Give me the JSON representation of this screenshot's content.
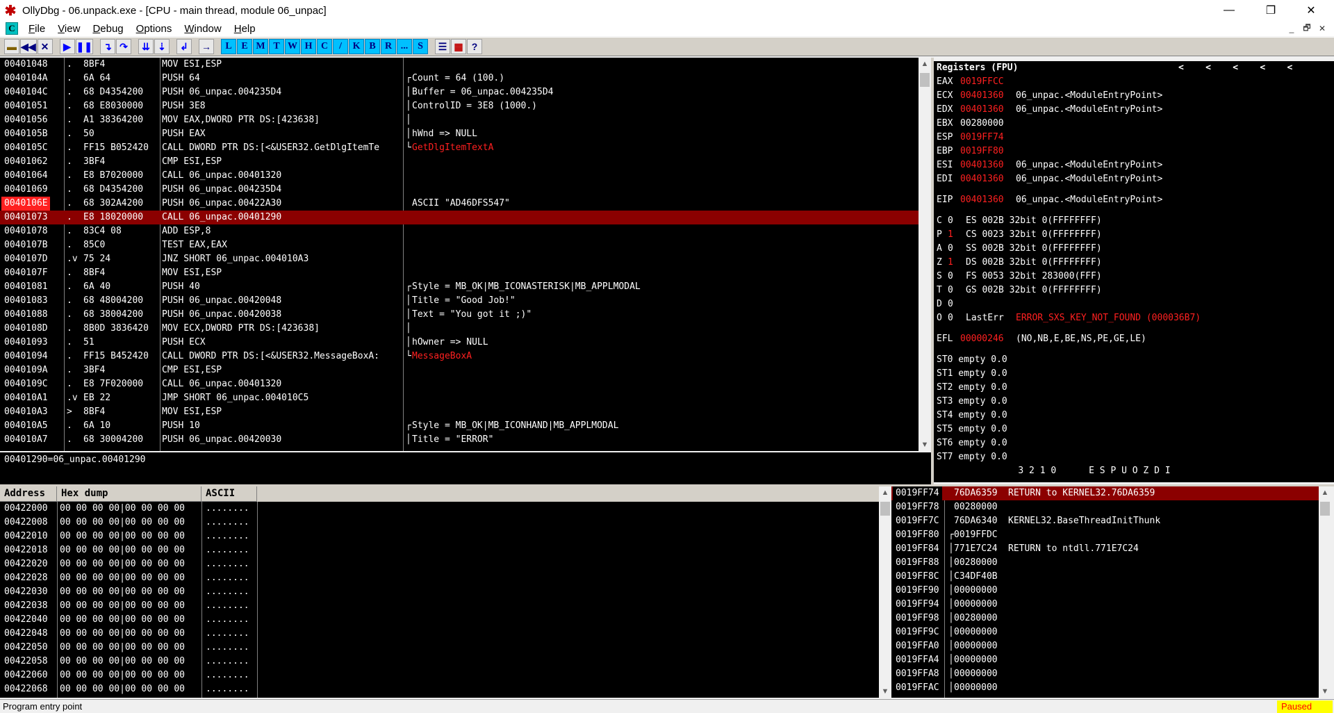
{
  "window": {
    "title": "OllyDbg - 06.unpack.exe - [CPU - main thread, module 06_unpac]",
    "minimize": "—",
    "restore": "❐",
    "close": "✕"
  },
  "menu": {
    "items": [
      "File",
      "View",
      "Debug",
      "Options",
      "Window",
      "Help"
    ],
    "mdi_min": "_",
    "mdi_restore": "🗗",
    "mdi_close": "✕"
  },
  "toolbar": {
    "letters": [
      "L",
      "E",
      "M",
      "T",
      "W",
      "H",
      "C",
      "/",
      "K",
      "B",
      "R",
      "...",
      "S"
    ]
  },
  "disasm": {
    "rows": [
      {
        "addr": "00401048",
        "m": ".",
        "hex": "8BF4",
        "asm": "MOV ESI,ESP",
        "cmt": "",
        "br": ""
      },
      {
        "addr": "0040104A",
        "m": ".",
        "hex": "6A 64",
        "asm": "PUSH 64",
        "cmt": "Count = 64 (100.)",
        "br": "┌"
      },
      {
        "addr": "0040104C",
        "m": ".",
        "hex": "68 D4354200",
        "asm": "PUSH 06_unpac.004235D4",
        "cmt": "Buffer = 06_unpac.004235D4",
        "br": "│"
      },
      {
        "addr": "00401051",
        "m": ".",
        "hex": "68 E8030000",
        "asm": "PUSH 3E8",
        "cmt": "ControlID = 3E8 (1000.)",
        "br": "│"
      },
      {
        "addr": "00401056",
        "m": ".",
        "hex": "A1 38364200",
        "asm": "MOV EAX,DWORD PTR DS:[423638]",
        "cmt": "",
        "br": "│"
      },
      {
        "addr": "0040105B",
        "m": ".",
        "hex": "50",
        "asm": "PUSH EAX",
        "cmt": "hWnd => NULL",
        "br": "│"
      },
      {
        "addr": "0040105C",
        "m": ".",
        "hex": "FF15 B052420",
        "asm": "CALL DWORD PTR DS:[<&USER32.GetDlgItemTe",
        "cmt": "GetDlgItemTextA",
        "br": "└",
        "cmtred": true
      },
      {
        "addr": "00401062",
        "m": ".",
        "hex": "3BF4",
        "asm": "CMP ESI,ESP",
        "cmt": "",
        "br": ""
      },
      {
        "addr": "00401064",
        "m": ".",
        "hex": "E8 B7020000",
        "asm": "CALL 06_unpac.00401320",
        "cmt": "",
        "br": ""
      },
      {
        "addr": "00401069",
        "m": ".",
        "hex": "68 D4354200",
        "asm": "PUSH 06_unpac.004235D4",
        "cmt": "",
        "br": ""
      },
      {
        "addr": "0040106E",
        "m": ".",
        "hex": "68 302A4200",
        "asm": "PUSH 06_unpac.00422A30",
        "cmt": "ASCII \"AD46DFS547\"",
        "br": "",
        "addrhl": true
      },
      {
        "addr": "00401073",
        "m": ".",
        "hex": "E8 18020000",
        "asm": "CALL 06_unpac.00401290",
        "cmt": "",
        "br": "",
        "sel": true
      },
      {
        "addr": "00401078",
        "m": ".",
        "hex": "83C4 08",
        "asm": "ADD ESP,8",
        "cmt": "",
        "br": ""
      },
      {
        "addr": "0040107B",
        "m": ".",
        "hex": "85C0",
        "asm": "TEST EAX,EAX",
        "cmt": "",
        "br": ""
      },
      {
        "addr": "0040107D",
        "m": ".v",
        "hex": "75 24",
        "asm": "JNZ SHORT 06_unpac.004010A3",
        "cmt": "",
        "br": ""
      },
      {
        "addr": "0040107F",
        "m": ".",
        "hex": "8BF4",
        "asm": "MOV ESI,ESP",
        "cmt": "",
        "br": ""
      },
      {
        "addr": "00401081",
        "m": ".",
        "hex": "6A 40",
        "asm": "PUSH 40",
        "cmt": "Style = MB_OK|MB_ICONASTERISK|MB_APPLMODAL",
        "br": "┌"
      },
      {
        "addr": "00401083",
        "m": ".",
        "hex": "68 48004200",
        "asm": "PUSH 06_unpac.00420048",
        "cmt": "Title = \"Good Job!\"",
        "br": "│"
      },
      {
        "addr": "00401088",
        "m": ".",
        "hex": "68 38004200",
        "asm": "PUSH 06_unpac.00420038",
        "cmt": "Text = \"You got it ;)\"",
        "br": "│"
      },
      {
        "addr": "0040108D",
        "m": ".",
        "hex": "8B0D 3836420",
        "asm": "MOV ECX,DWORD PTR DS:[423638]",
        "cmt": "",
        "br": "│"
      },
      {
        "addr": "00401093",
        "m": ".",
        "hex": "51",
        "asm": "PUSH ECX",
        "cmt": "hOwner => NULL",
        "br": "│"
      },
      {
        "addr": "00401094",
        "m": ".",
        "hex": "FF15 B452420",
        "asm": "CALL DWORD PTR DS:[<&USER32.MessageBoxA:",
        "cmt": "MessageBoxA",
        "br": "└",
        "cmtred": true
      },
      {
        "addr": "0040109A",
        "m": ".",
        "hex": "3BF4",
        "asm": "CMP ESI,ESP",
        "cmt": "",
        "br": ""
      },
      {
        "addr": "0040109C",
        "m": ".",
        "hex": "E8 7F020000",
        "asm": "CALL 06_unpac.00401320",
        "cmt": "",
        "br": ""
      },
      {
        "addr": "004010A1",
        "m": ".v",
        "hex": "EB 22",
        "asm": "JMP SHORT 06_unpac.004010C5",
        "cmt": "",
        "br": ""
      },
      {
        "addr": "004010A3",
        "m": ">",
        "hex": "8BF4",
        "asm": "MOV ESI,ESP",
        "cmt": "",
        "br": ""
      },
      {
        "addr": "004010A5",
        "m": ".",
        "hex": "6A 10",
        "asm": "PUSH 10",
        "cmt": "Style = MB_OK|MB_ICONHAND|MB_APPLMODAL",
        "br": "┌"
      },
      {
        "addr": "004010A7",
        "m": ".",
        "hex": "68 30004200",
        "asm": "PUSH 06_unpac.00420030",
        "cmt": "Title = \"ERROR\"",
        "br": "│"
      }
    ]
  },
  "info": {
    "text": "00401290=06_unpac.00401290"
  },
  "registers": {
    "header": "Registers (FPU)",
    "arrows": "<    <    <    <    <",
    "gp": [
      {
        "n": "EAX",
        "v": "0019FFCC",
        "d": "",
        "red": true
      },
      {
        "n": "ECX",
        "v": "00401360",
        "d": "06_unpac.<ModuleEntryPoint>",
        "red": true
      },
      {
        "n": "EDX",
        "v": "00401360",
        "d": "06_unpac.<ModuleEntryPoint>",
        "red": true
      },
      {
        "n": "EBX",
        "v": "00280000",
        "d": "",
        "red": false
      },
      {
        "n": "ESP",
        "v": "0019FF74",
        "d": "",
        "red": true
      },
      {
        "n": "EBP",
        "v": "0019FF80",
        "d": "",
        "red": true
      },
      {
        "n": "ESI",
        "v": "00401360",
        "d": "06_unpac.<ModuleEntryPoint>",
        "red": true
      },
      {
        "n": "EDI",
        "v": "00401360",
        "d": "06_unpac.<ModuleEntryPoint>",
        "red": true
      }
    ],
    "eip": {
      "n": "EIP",
      "v": "00401360",
      "d": "06_unpac.<ModuleEntryPoint>"
    },
    "flags": [
      {
        "f": "C",
        "v": "0",
        "red": false,
        "seg": "ES 002B 32bit 0(FFFFFFFF)"
      },
      {
        "f": "P",
        "v": "1",
        "red": true,
        "seg": "CS 0023 32bit 0(FFFFFFFF)"
      },
      {
        "f": "A",
        "v": "0",
        "red": false,
        "seg": "SS 002B 32bit 0(FFFFFFFF)"
      },
      {
        "f": "Z",
        "v": "1",
        "red": true,
        "seg": "DS 002B 32bit 0(FFFFFFFF)"
      },
      {
        "f": "S",
        "v": "0",
        "red": false,
        "seg": "FS 0053 32bit 283000(FFF)"
      },
      {
        "f": "T",
        "v": "0",
        "red": false,
        "seg": "GS 002B 32bit 0(FFFFFFFF)"
      },
      {
        "f": "D",
        "v": "0",
        "red": false,
        "seg": ""
      }
    ],
    "lasterr": {
      "f": "O",
      "v": "0",
      "label": "LastErr",
      "val": "ERROR_SXS_KEY_NOT_FOUND (000036B7)"
    },
    "efl": {
      "n": "EFL",
      "v": "00000246",
      "d": "(NO,NB,E,BE,NS,PE,GE,LE)"
    },
    "st": [
      "ST0 empty 0.0",
      "ST1 empty 0.0",
      "ST2 empty 0.0",
      "ST3 empty 0.0",
      "ST4 empty 0.0",
      "ST5 empty 0.0",
      "ST6 empty 0.0",
      "ST7 empty 0.0"
    ],
    "fpu_footer": "               3 2 1 0      E S P U O Z D I"
  },
  "dump": {
    "headers": [
      "Address",
      "Hex dump",
      "ASCII"
    ],
    "rows": [
      {
        "a": "00422000",
        "h": "00 00 00 00|00 00 00 00",
        "s": "........"
      },
      {
        "a": "00422008",
        "h": "00 00 00 00|00 00 00 00",
        "s": "........"
      },
      {
        "a": "00422010",
        "h": "00 00 00 00|00 00 00 00",
        "s": "........"
      },
      {
        "a": "00422018",
        "h": "00 00 00 00|00 00 00 00",
        "s": "........"
      },
      {
        "a": "00422020",
        "h": "00 00 00 00|00 00 00 00",
        "s": "........"
      },
      {
        "a": "00422028",
        "h": "00 00 00 00|00 00 00 00",
        "s": "........"
      },
      {
        "a": "00422030",
        "h": "00 00 00 00|00 00 00 00",
        "s": "........"
      },
      {
        "a": "00422038",
        "h": "00 00 00 00|00 00 00 00",
        "s": "........"
      },
      {
        "a": "00422040",
        "h": "00 00 00 00|00 00 00 00",
        "s": "........"
      },
      {
        "a": "00422048",
        "h": "00 00 00 00|00 00 00 00",
        "s": "........"
      },
      {
        "a": "00422050",
        "h": "00 00 00 00|00 00 00 00",
        "s": "........"
      },
      {
        "a": "00422058",
        "h": "00 00 00 00|00 00 00 00",
        "s": "........"
      },
      {
        "a": "00422060",
        "h": "00 00 00 00|00 00 00 00",
        "s": "........"
      },
      {
        "a": "00422068",
        "h": "00 00 00 00|00 00 00 00",
        "s": "........"
      }
    ]
  },
  "stack": {
    "rows": [
      {
        "a": "0019FF74",
        "v": "76DA6359",
        "c": "RETURN to KERNEL32.76DA6359",
        "sel": true,
        "br": " "
      },
      {
        "a": "0019FF78",
        "v": "00280000",
        "c": "",
        "br": " "
      },
      {
        "a": "0019FF7C",
        "v": "76DA6340",
        "c": "KERNEL32.BaseThreadInitThunk",
        "br": " "
      },
      {
        "a": "0019FF80",
        "v": "0019FFDC",
        "c": "",
        "br": "┌"
      },
      {
        "a": "0019FF84",
        "v": "771E7C24",
        "c": "RETURN to ntdll.771E7C24",
        "br": "│"
      },
      {
        "a": "0019FF88",
        "v": "00280000",
        "c": "",
        "br": "│"
      },
      {
        "a": "0019FF8C",
        "v": "C34DF40B",
        "c": "",
        "br": "│"
      },
      {
        "a": "0019FF90",
        "v": "00000000",
        "c": "",
        "br": "│"
      },
      {
        "a": "0019FF94",
        "v": "00000000",
        "c": "",
        "br": "│"
      },
      {
        "a": "0019FF98",
        "v": "00280000",
        "c": "",
        "br": "│"
      },
      {
        "a": "0019FF9C",
        "v": "00000000",
        "c": "",
        "br": "│"
      },
      {
        "a": "0019FFA0",
        "v": "00000000",
        "c": "",
        "br": "│"
      },
      {
        "a": "0019FFA4",
        "v": "00000000",
        "c": "",
        "br": "│"
      },
      {
        "a": "0019FFA8",
        "v": "00000000",
        "c": "",
        "br": "│"
      },
      {
        "a": "0019FFAC",
        "v": "00000000",
        "c": "",
        "br": "│"
      }
    ]
  },
  "status": {
    "message": "Program entry point",
    "state": "Paused"
  },
  "colors": {
    "selection": "#8b0000",
    "red": "#ff2020",
    "toolbar_letter": "#00c0ff"
  }
}
